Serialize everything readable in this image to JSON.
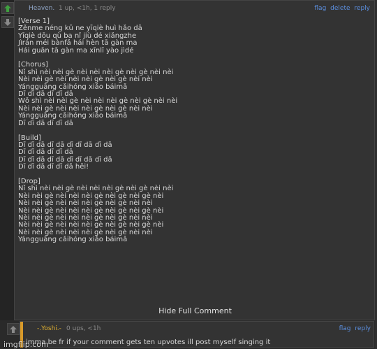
{
  "comment": {
    "author": "Heaven.",
    "meta": "1 up, <1h, 1 reply",
    "actions": [
      "flag",
      "delete",
      "reply"
    ],
    "lines": [
      "[Verse 1]",
      "Zěnme néng kū ne yīqiè huì hǎo dā",
      "Yīqiè dōu qù ba nǐ jiù dé xiǎngzhe",
      "Jìrán méi bànfǎ hái hèn tā gàn ma",
      "Hái guān tā gàn ma xīnlǐ yào jìdé",
      "",
      "[Chorus]",
      "Nǐ shì nèi nèi gè nèi nèi nèi gè nèi gè nèi nèi",
      "Nèi nèi gè nèi nèi nèi gè nèi gè nèi nèi",
      "Yángguāng cǎihóng xiǎo báimǎ",
      "Dī dī dā dī dī dā",
      "Wǒ shì nèi nèi gè nèi nèi nèi gè nèi gè nèi nèi",
      "Nèi nèi gè nèi nèi nèi gè nèi gè nèi nèi",
      "Yángguāng cǎihóng xiǎo báimǎ",
      "Dī dī dā dī dī dā",
      "",
      "[Build]",
      "Dī dī dā dī dā dī dī dā dī dā",
      "Dī dī dā dī dī dā",
      "Dī dī dā dī dā dī dī dā dī dā",
      "Dī dī dā dī dī dā hēi!",
      "",
      "[Drop]",
      "Nǐ shì nèi nèi gè nèi nèi nèi gè nèi gè nèi nèi",
      "Nèi nèi gè nèi nèi nèi gè nèi gè nèi gè nèi",
      "Nèi nèi gè nèi nèi nèi gè nèi gè nèi nèi",
      "Nèi nèi gè nèi nèi nèi gè nèi gè nèi gè nèi",
      "Nèi nèi gè nèi nèi nèi gè nèi gè nèi nèi",
      "Nèi nèi gè nèi nèi nèi gè nèi gè nèi gè nèi",
      "Nèi nèi gè nèi nèi nèi gè nèi gè nèi nèi",
      "Yángguāng cǎihóng xiǎo báimǎ"
    ],
    "hide_label": "Hide Full Comment"
  },
  "reply": {
    "author": "-.Yoshi.-",
    "meta": "0 ups, <1h",
    "actions": [
      "flag",
      "reply"
    ],
    "text": "imma be fr if your comment gets ten upvotes ill post myself singing it"
  },
  "watermark": "imgflip.com",
  "colors": {
    "accent": "#d89a2a",
    "link": "#5b8fe0",
    "upvote": "#3fa03f"
  },
  "icons": {
    "upvote": "up-arrow-icon",
    "downvote": "down-arrow-icon"
  }
}
